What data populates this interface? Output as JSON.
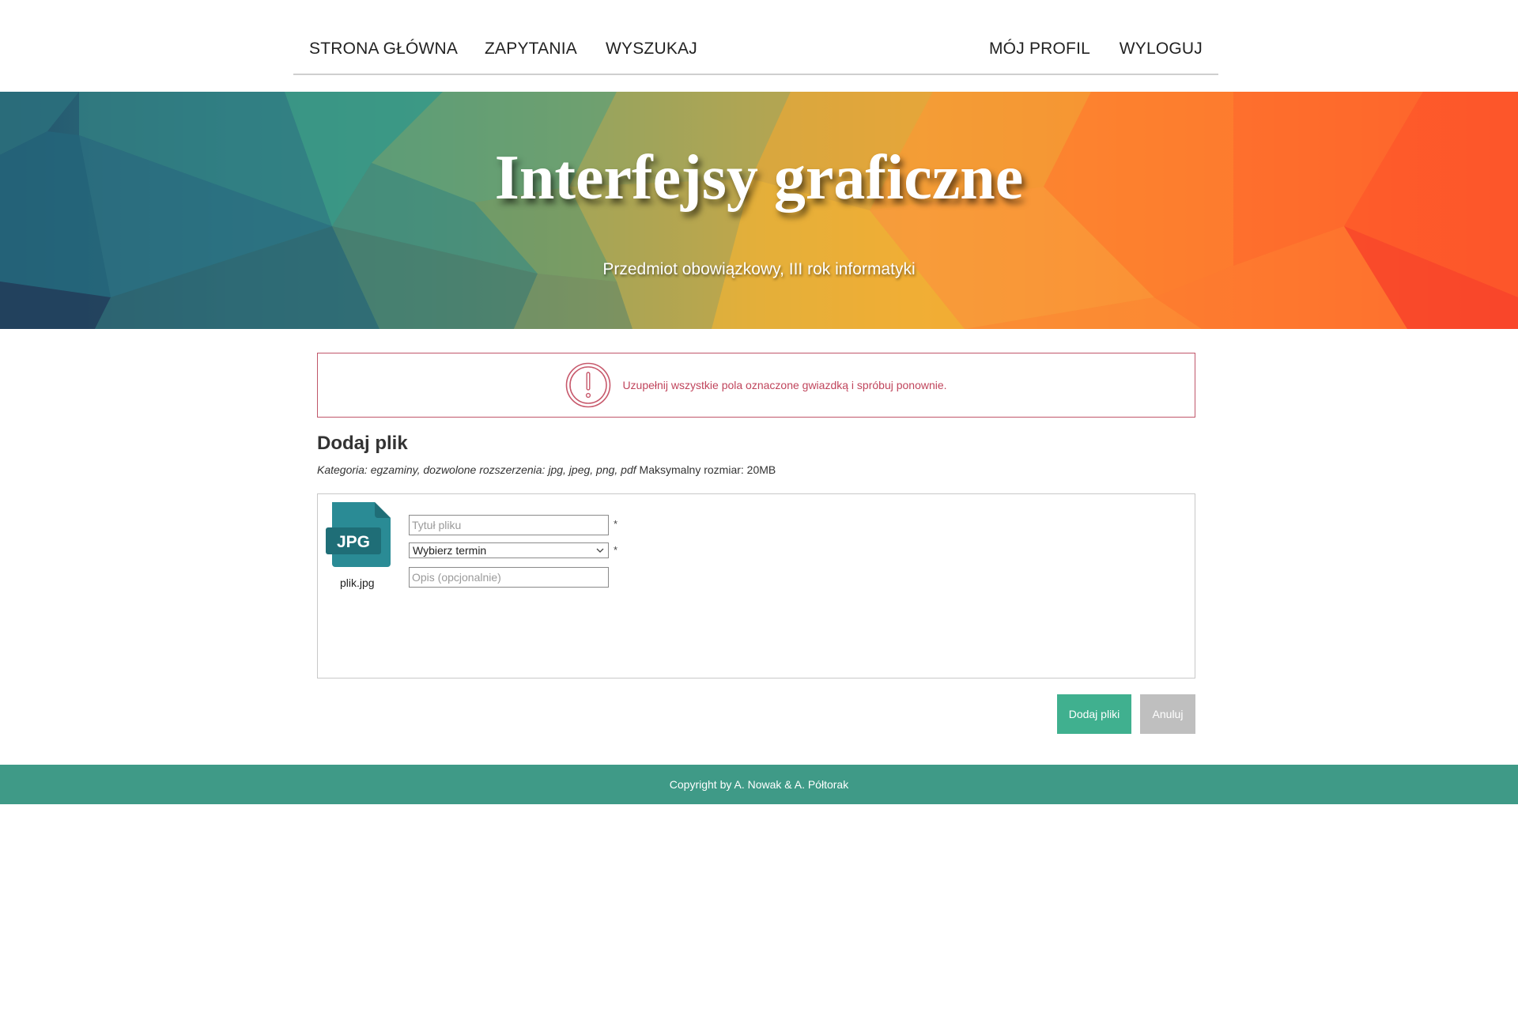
{
  "nav": {
    "home": "STRONA GŁÓWNA",
    "queries": "ZAPYTANIA",
    "search": "WYSZUKAJ",
    "profile": "MÓJ PROFIL",
    "logout": "WYLOGUJ"
  },
  "hero": {
    "title": "Interfejsy graficzne",
    "subtitle": "Przedmiot obowiązkowy, III rok informatyki"
  },
  "alert": {
    "icon": "exclamation-circle-icon",
    "message": "Uzupełnij wszystkie pola oznaczone gwiazdką i spróbuj ponownie.",
    "color": "#c0455c"
  },
  "form": {
    "title": "Dodaj plik",
    "note_italic": "Kategoria: egzaminy, dozwolone rozszerzenia: jpg, jpeg, png, pdf",
    "note_plain": " Maksymalny rozmiar: 20MB",
    "file": {
      "icon": "jpg-file-icon",
      "badge": "JPG",
      "name": "plik.jpg"
    },
    "fields": {
      "title_placeholder": "Tytuł pliku",
      "term_selected": "Wybierz termin",
      "description_placeholder": "Opis (opcjonalnie)",
      "required_mark": "*"
    },
    "buttons": {
      "add": "Dodaj pliki",
      "cancel": "Anuluj"
    }
  },
  "footer": {
    "copyright": "Copyright by A. Nowak & A. Półtorak"
  },
  "colors": {
    "accent": "#40b08f",
    "footer": "#3f9a87",
    "cancel": "#bfbfbf",
    "file_icon": "#2a8b95"
  }
}
